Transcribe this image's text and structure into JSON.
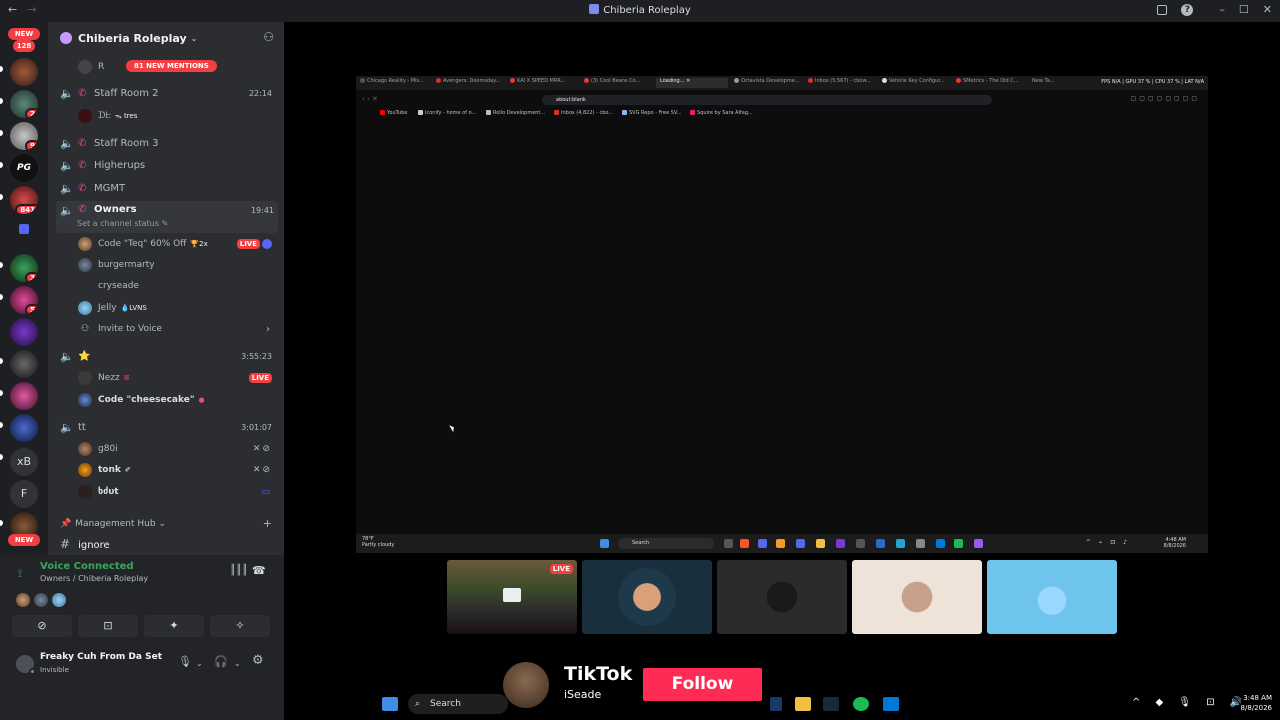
{
  "window": {
    "title": "Chiberia Roleplay",
    "nav_back": "←",
    "nav_forward": "→",
    "help_icon": "?",
    "minimize": "–",
    "maximize": "☐",
    "close": "✕"
  },
  "rail": {
    "new_top": "NEW",
    "new_top_count": "128",
    "badges": [
      "2",
      "9",
      "841",
      "3",
      "5"
    ],
    "text_servers": [
      "xB",
      "F"
    ],
    "new_bottom": "NEW"
  },
  "guild": {
    "name": "Chiberia Roleplay",
    "chevron": "⌄"
  },
  "channels": {
    "top_user_label": "R",
    "mentions_banner": "81 NEW MENTIONS",
    "staff_room_2": {
      "name": "Staff Room 2",
      "time": "22:14"
    },
    "staff_room_2_user": {
      "name": "ᗪᖶ",
      "tag": "ᯓ tres"
    },
    "staff_room_3": {
      "name": "Staff Room 3"
    },
    "higherups": {
      "name": "Higherups"
    },
    "mgmt": {
      "name": "MGMT"
    },
    "owners": {
      "name": "Owners",
      "time": "19:41",
      "status": "Set a channel status ✎"
    },
    "owners_users": [
      {
        "name": "Code \"Teq\" 60% Off",
        "tag": "🏆2x",
        "live": "LIVE"
      },
      {
        "name": "burgermarty"
      },
      {
        "name": "cryseade"
      },
      {
        "name": "Jelly",
        "tag": "💧LVNS"
      }
    ],
    "invite_to_voice": "Invite to Voice",
    "star_channel": {
      "name": "⭐",
      "time": "3:55:23"
    },
    "star_users": [
      {
        "name": "Nezz",
        "tag": "ꕤ",
        "live": "LIVE"
      },
      {
        "name": "Code \"cheesecake\"",
        "tag": "●"
      }
    ],
    "tt_channel": {
      "name": "tt",
      "time": "3:01:07"
    },
    "tt_users": [
      {
        "name": "g80i"
      },
      {
        "name": "tonk",
        "tag": "✐"
      },
      {
        "name": "ხძυt"
      }
    ],
    "category": {
      "name": "Management Hub",
      "chevron": "⌄",
      "plus": "+"
    },
    "ignore": {
      "hash": "#",
      "name": "ignore"
    }
  },
  "voice": {
    "title": "Voice Connected",
    "subtitle": "Owners / Chiberia Roleplay",
    "buttons": [
      "⊘",
      "⊡",
      "✦",
      "✧"
    ]
  },
  "userbar": {
    "display_name": "Freaky Cuh From Da Set",
    "status": "Invisible",
    "mic": "🎙",
    "headset": "🎧",
    "settings": "⚙"
  },
  "stream": {
    "tabs": [
      "Chicago Reality - Mis...",
      "Avengers: Doomsday...",
      "KAI X SPEED MRR...",
      "(3) Cool Beans Co...",
      "Loading...",
      "Octavista Developme...",
      "Inbox (5,567) - cbow...",
      "Vehicle Key Configur...",
      "SMetrics - The Old C...",
      "New Ta..."
    ],
    "hud": "FPS N/A | GPU 37 % | CPU 37 % | LAT N/A",
    "url": "about:blank",
    "bookmarks": [
      "YouTube",
      "Iconify - home of o...",
      "Rollo Development...",
      "Inbox (4,822) - cbo...",
      "SVG Repo - Free SV...",
      "Squire by Sara Alfag..."
    ],
    "weather_temp": "78°F",
    "weather_desc": "Partly cloudy",
    "search_label": "Search",
    "clock_time": "4:48 AM",
    "clock_date": "8/8/2026"
  },
  "tiles": {
    "first_live": "LIVE"
  },
  "tiktok": {
    "name": "TikTok",
    "handle": "iSeade",
    "follow": "Follow"
  },
  "taskbar": {
    "search_label": "Search",
    "clock_time": "3:48 AM",
    "clock_date": "8/8/2026",
    "tray": "^ ◆ 🎙 ⊡ 🔊"
  }
}
